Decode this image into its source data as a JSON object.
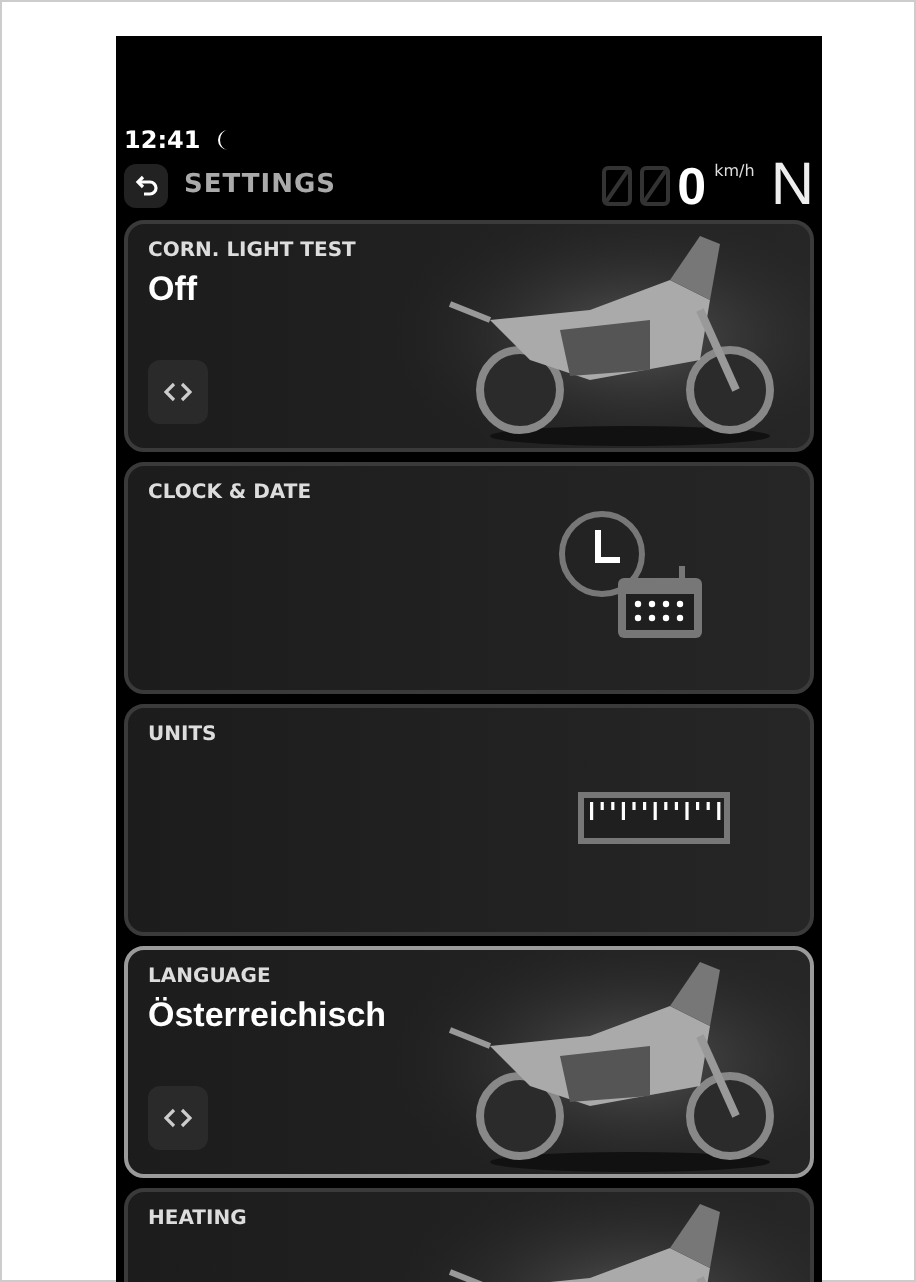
{
  "status_bar": {
    "time": "12:41",
    "night_mode": true
  },
  "header": {
    "title": "SETTINGS",
    "speed": "0",
    "unit": "km/h",
    "gear": "N"
  },
  "cards": [
    {
      "label": "CORN. LIGHT TEST",
      "value": "Off",
      "kind": "picture",
      "selected": false
    },
    {
      "label": "CLOCK & DATE",
      "kind": "clock",
      "selected": false
    },
    {
      "label": "UNITS",
      "kind": "ruler",
      "selected": false
    },
    {
      "label": "LANGUAGE",
      "value": "Österreichisch",
      "kind": "picture",
      "selected": true
    },
    {
      "label": "HEATING",
      "kind": "picture",
      "selected": false
    }
  ]
}
